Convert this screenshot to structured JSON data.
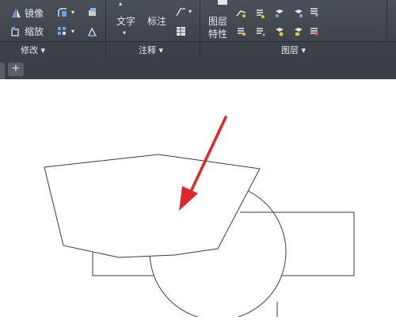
{
  "ribbon": {
    "modify_panel": {
      "mirror_label": "镜像",
      "scale_label": "缩放",
      "title": "修改 ▾"
    },
    "annotation_panel": {
      "text_label": "文字",
      "dimension_label": "标注",
      "title": "注释 ▾"
    },
    "layer_panel": {
      "layer_properties_label_line1": "图层",
      "layer_properties_label_line2": "特性",
      "title": "图层 ▾"
    }
  },
  "tabs": {
    "add_label": "+"
  },
  "colors": {
    "ribbon_bg": "#43484f",
    "arrow": "#e0262b",
    "line": "#3c3c3c"
  }
}
